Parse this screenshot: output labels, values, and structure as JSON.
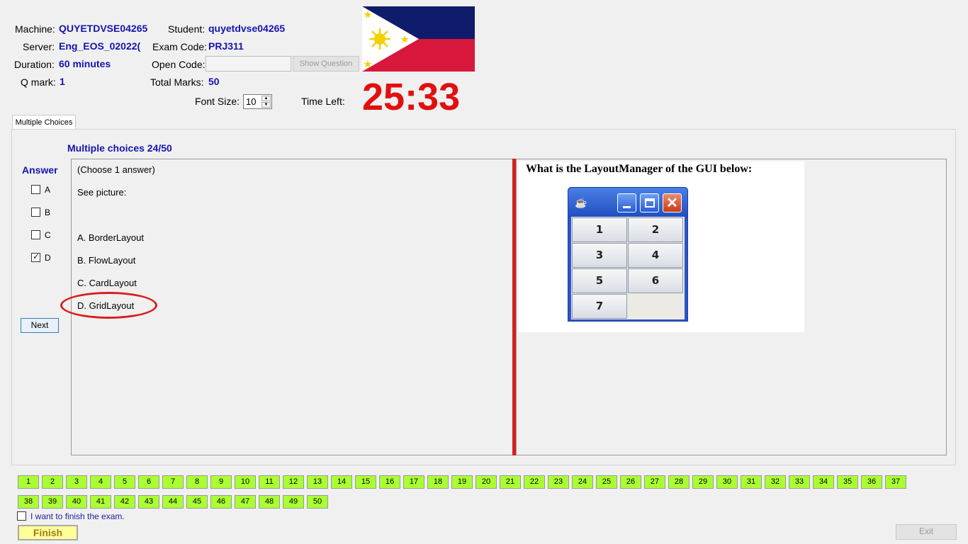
{
  "header": {
    "machine_label": "Machine:",
    "machine_value": "QUYETDVSE04265",
    "student_label": "Student:",
    "student_value": "quyetdvse04265",
    "server_label": "Server:",
    "server_value": "Eng_EOS_02022(",
    "exam_code_label": "Exam Code:",
    "exam_code_value": "PRJ311",
    "duration_label": "Duration:",
    "duration_value": "60 minutes",
    "open_code_label": "Open Code:",
    "open_code_value": "",
    "show_question_label": "Show Question",
    "qmark_label": "Q mark:",
    "qmark_value": "1",
    "total_marks_label": "Total Marks:",
    "total_marks_value": "50",
    "font_size_label": "Font Size:",
    "font_size_value": "10",
    "time_left_label": "Time Left:",
    "time_left_value": "25:33"
  },
  "tab": {
    "label": "Multiple Choices"
  },
  "question": {
    "heading": "Multiple choices 24/50",
    "answer_label": "Answer",
    "choices": [
      {
        "label": "A",
        "checked": false
      },
      {
        "label": "B",
        "checked": false
      },
      {
        "label": "C",
        "checked": false
      },
      {
        "label": "D",
        "checked": true
      }
    ],
    "next_label": "Next",
    "instruction": "(Choose 1 answer)",
    "see_picture": "See picture:",
    "options": [
      "A. BorderLayout",
      "B. FlowLayout",
      "C. CardLayout",
      "D. GridLayout"
    ],
    "image_title": "What is the LayoutManager of the GUI below:",
    "grid_buttons": [
      "1",
      "2",
      "3",
      "4",
      "5",
      "6",
      "7"
    ]
  },
  "navigation": {
    "numbers": [
      "1",
      "2",
      "3",
      "4",
      "5",
      "6",
      "7",
      "8",
      "9",
      "10",
      "11",
      "12",
      "13",
      "14",
      "15",
      "16",
      "17",
      "18",
      "19",
      "20",
      "21",
      "22",
      "23",
      "24",
      "25",
      "26",
      "27",
      "28",
      "29",
      "30",
      "31",
      "32",
      "33",
      "34",
      "35",
      "36",
      "37",
      "38",
      "39",
      "40",
      "41",
      "42",
      "43",
      "44",
      "45",
      "46",
      "47",
      "48",
      "49",
      "50"
    ]
  },
  "footer": {
    "finish_checkbox_label": "I want to finish the exam.",
    "finish_label": "Finish",
    "exit_label": "Exit"
  },
  "colors": {
    "value_blue": "#1515b0",
    "timer_red": "#e01010",
    "nav_green": "#aaff33",
    "flag_blue": "#0f1b6b",
    "flag_red": "#d8173d",
    "flag_yellow": "#f5d000"
  }
}
